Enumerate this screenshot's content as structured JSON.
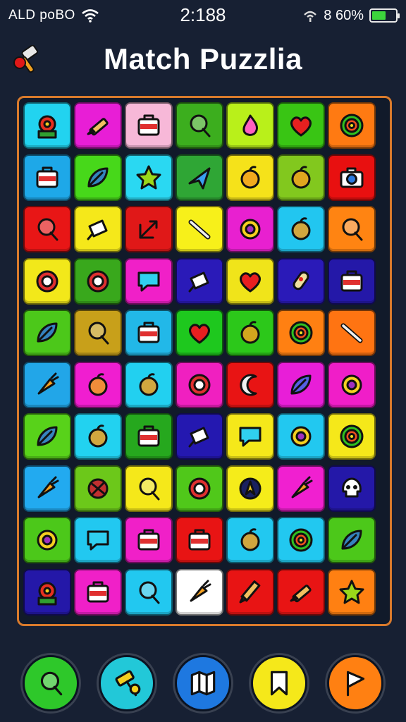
{
  "status": {
    "carrier": "ALD poBO",
    "time": "2:188",
    "battery_text": "8 60%",
    "battery_level": 0.6
  },
  "header": {
    "title": "Match Puzzlia",
    "hammer_icon": "hammer-icon"
  },
  "board": {
    "rows": [
      [
        {
          "color": "#22d3f0",
          "icon": "flower"
        },
        {
          "color": "#e81ed6",
          "icon": "brush"
        },
        {
          "color": "#f7b8d8",
          "icon": "bag"
        },
        {
          "color": "#3cae1e",
          "icon": "lollipop"
        },
        {
          "color": "#b9f01a",
          "icon": "drop"
        },
        {
          "color": "#39c514",
          "icon": "heart"
        },
        {
          "color": "#ff7a12",
          "icon": "target"
        }
      ],
      [
        {
          "color": "#1ea8e8",
          "icon": "bag"
        },
        {
          "color": "#47d81a",
          "icon": "leaf"
        },
        {
          "color": "#2ad8f2",
          "icon": "star"
        },
        {
          "color": "#2fa635",
          "icon": "plane"
        },
        {
          "color": "#f5e21a",
          "icon": "fruit"
        },
        {
          "color": "#82c81e",
          "icon": "fruit"
        },
        {
          "color": "#e81010",
          "icon": "camera"
        }
      ],
      [
        {
          "color": "#e81616",
          "icon": "lollipop"
        },
        {
          "color": "#f5e81a",
          "icon": "icecream"
        },
        {
          "color": "#e01818",
          "icon": "arrow"
        },
        {
          "color": "#f7f01a",
          "icon": "knife"
        },
        {
          "color": "#e820d0",
          "icon": "ring"
        },
        {
          "color": "#22c6f0",
          "icon": "fruit"
        },
        {
          "color": "#ff8412",
          "icon": "lollipop"
        }
      ],
      [
        {
          "color": "#f2e81a",
          "icon": "gear"
        },
        {
          "color": "#39a81c",
          "icon": "gear"
        },
        {
          "color": "#f020c8",
          "icon": "chat"
        },
        {
          "color": "#2a1ab8",
          "icon": "icecream"
        },
        {
          "color": "#f0e41a",
          "icon": "heart"
        },
        {
          "color": "#2a1ab8",
          "icon": "rocket"
        },
        {
          "color": "#2418a8",
          "icon": "bag"
        }
      ],
      [
        {
          "color": "#4cc81a",
          "icon": "leaf"
        },
        {
          "color": "#c8a01a",
          "icon": "lollipop"
        },
        {
          "color": "#22b8e8",
          "icon": "bag"
        },
        {
          "color": "#1ec81e",
          "icon": "heart"
        },
        {
          "color": "#2cc81a",
          "icon": "fruit"
        },
        {
          "color": "#ff8012",
          "icon": "target"
        },
        {
          "color": "#ff7412",
          "icon": "knife"
        }
      ],
      [
        {
          "color": "#22a6e8",
          "icon": "carrot"
        },
        {
          "color": "#f01ed0",
          "icon": "fruit"
        },
        {
          "color": "#22d0f0",
          "icon": "fruit"
        },
        {
          "color": "#f020c0",
          "icon": "gear"
        },
        {
          "color": "#e81414",
          "icon": "moon"
        },
        {
          "color": "#e81ed8",
          "icon": "leaf"
        },
        {
          "color": "#f01ec8",
          "icon": "ring"
        }
      ],
      [
        {
          "color": "#58d21a",
          "icon": "leaf"
        },
        {
          "color": "#22d2f0",
          "icon": "fruit"
        },
        {
          "color": "#26a81e",
          "icon": "bag"
        },
        {
          "color": "#2418b0",
          "icon": "icecream"
        },
        {
          "color": "#f5e81a",
          "icon": "chat"
        },
        {
          "color": "#22c8f0",
          "icon": "ring"
        },
        {
          "color": "#f5e81a",
          "icon": "target"
        }
      ],
      [
        {
          "color": "#22aaf0",
          "icon": "carrot"
        },
        {
          "color": "#6cc81a",
          "icon": "ball"
        },
        {
          "color": "#f5e81a",
          "icon": "lollipop"
        },
        {
          "color": "#50c81a",
          "icon": "gear"
        },
        {
          "color": "#f5ec1a",
          "icon": "compass"
        },
        {
          "color": "#f020d0",
          "icon": "carrot"
        },
        {
          "color": "#2418a8",
          "icon": "skull"
        }
      ],
      [
        {
          "color": "#4cc81a",
          "icon": "ring"
        },
        {
          "color": "#22c8f0",
          "icon": "chat"
        },
        {
          "color": "#f020c8",
          "icon": "bag"
        },
        {
          "color": "#e81414",
          "icon": "bag"
        },
        {
          "color": "#22c8f0",
          "icon": "fruit"
        },
        {
          "color": "#22c8f0",
          "icon": "target"
        },
        {
          "color": "#4cc81a",
          "icon": "leaf"
        }
      ],
      [
        {
          "color": "#2418a8",
          "icon": "flower"
        },
        {
          "color": "#f020c8",
          "icon": "bag"
        },
        {
          "color": "#22c8f0",
          "icon": "lollipop"
        },
        {
          "color": "#ffffff",
          "icon": "carrot"
        },
        {
          "color": "#e81414",
          "icon": "pencil"
        },
        {
          "color": "#e81414",
          "icon": "brush"
        },
        {
          "color": "#ff8012",
          "icon": "star"
        }
      ]
    ]
  },
  "toolbar": {
    "tools": [
      {
        "name": "lollipop-tool",
        "icon": "lollipop",
        "color": "#2ec82a"
      },
      {
        "name": "hammer-tool",
        "icon": "hammer",
        "color": "#22c8d8"
      },
      {
        "name": "map-tool",
        "icon": "map",
        "color": "#1e78e0"
      },
      {
        "name": "bookmark-tool",
        "icon": "bookmark",
        "color": "#f5e81a"
      },
      {
        "name": "flag-tool",
        "icon": "flag",
        "color": "#ff8012"
      }
    ]
  }
}
